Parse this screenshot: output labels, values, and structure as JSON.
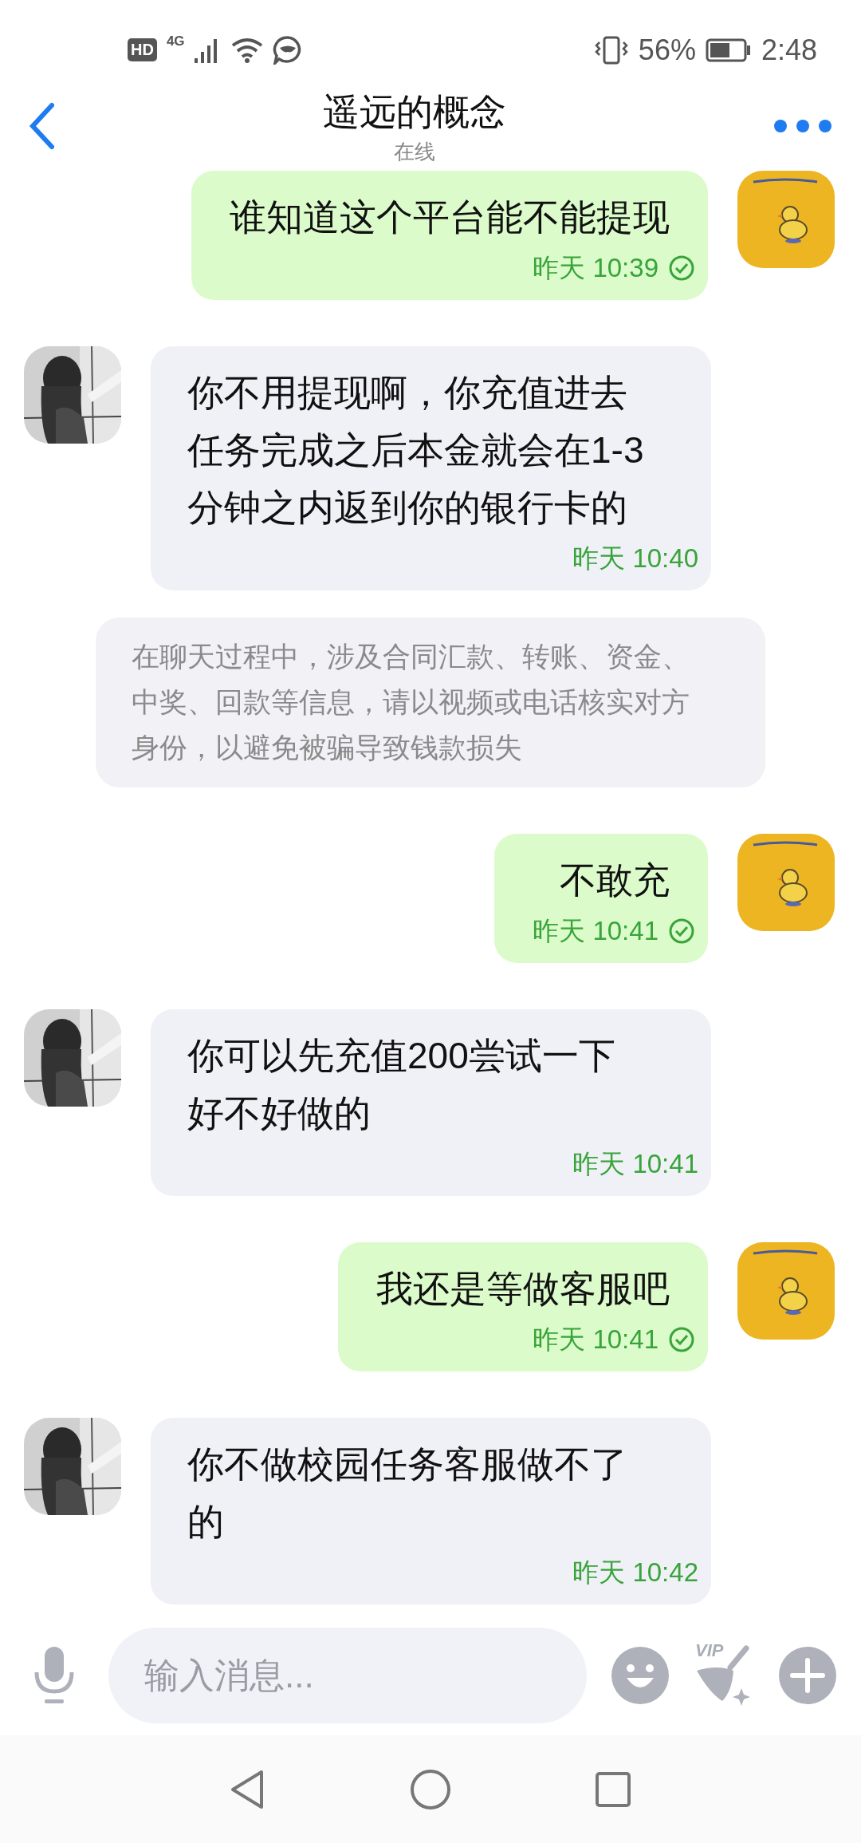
{
  "status_bar": {
    "hd": "HD",
    "network": "4G",
    "battery_percent": "56%",
    "time": "2:48"
  },
  "header": {
    "title": "遥远的概念",
    "subtitle": "在线"
  },
  "messages": [
    {
      "kind": "outgoing",
      "text": "谁知道这个平台能不能提现",
      "time": "昨天 10:39",
      "read": true
    },
    {
      "kind": "incoming",
      "text": "你不用提现啊，你充值进去任务完成之后本金就会在1-3分钟之内返到你的银行卡的",
      "time": "昨天 10:40"
    },
    {
      "kind": "notice",
      "text": "在聊天过程中，涉及合同汇款、转账、资金、中奖、回款等信息，请以视频或电话核实对方身份，以避免被骗导致钱款损失"
    },
    {
      "kind": "outgoing",
      "text": "不敢充",
      "time": "昨天 10:41",
      "read": true
    },
    {
      "kind": "incoming",
      "text": "你可以先充值200尝试一下好不好做的",
      "time": "昨天 10:41"
    },
    {
      "kind": "outgoing",
      "text": "我还是等做客服吧",
      "time": "昨天 10:41",
      "read": true
    },
    {
      "kind": "incoming",
      "text": "你不做校园任务客服做不了的",
      "time": "昨天 10:42"
    }
  ],
  "composer": {
    "placeholder": "输入消息...",
    "vip_label": "VIP"
  }
}
